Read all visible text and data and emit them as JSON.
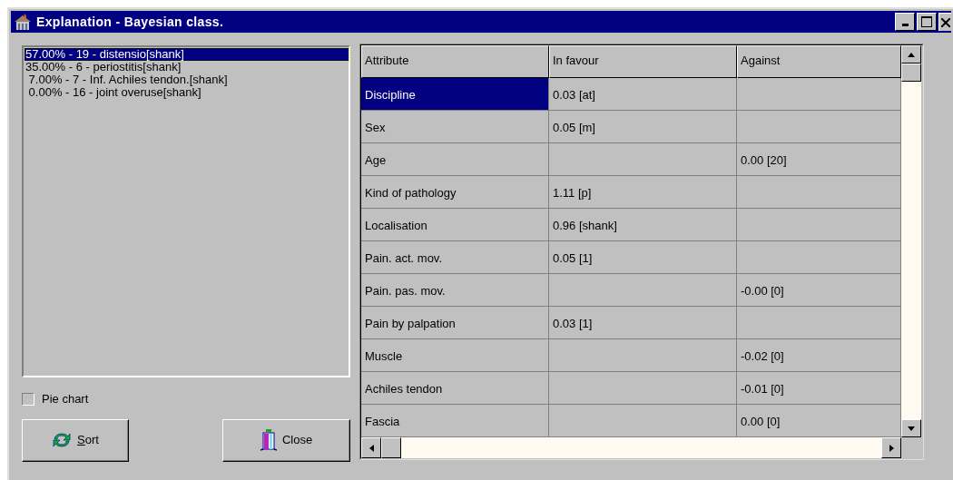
{
  "window": {
    "title": "Explanation - Bayesian class."
  },
  "classes": [
    {
      "label": "57.00% - 19 - distensio[shank]",
      "selected": true
    },
    {
      "label": "35.00% - 6 - periostitis[shank]",
      "selected": false
    },
    {
      "label": " 7.00% - 7 - Inf. Achiles tendon.[shank]",
      "selected": false
    },
    {
      "label": " 0.00% - 16 - joint overuse[shank]",
      "selected": false
    }
  ],
  "pie_chart": {
    "label": "Pie chart",
    "checked": false
  },
  "buttons": [
    {
      "label": "Sort",
      "kind": "sort"
    },
    {
      "label": "Close",
      "kind": "close"
    }
  ],
  "table": {
    "columns": [
      "Attribute",
      "In favour",
      "Against"
    ],
    "rows": [
      {
        "attribute": "Discipline",
        "in_favour": "0.03 [at]",
        "selected": true
      },
      {
        "attribute": "Sex",
        "in_favour": "0.05 [m]",
        "selected": false
      },
      {
        "attribute": "Age",
        "against": "0.00 [20]",
        "selected": false
      },
      {
        "attribute": "Kind of pathology",
        "in_favour": "1.11 [p]",
        "selected": false
      },
      {
        "attribute": "Localisation",
        "in_favour": "0.96 [shank]",
        "selected": false
      },
      {
        "attribute": "Pain. act. mov.",
        "in_favour": "0.05 [1]",
        "selected": false
      },
      {
        "attribute": "Pain. pas. mov.",
        "against": "-0.00 [0]",
        "selected": false
      },
      {
        "attribute": "Pain by palpation",
        "in_favour": "0.03 [1]",
        "selected": false
      },
      {
        "attribute": "Muscle",
        "against": "-0.02 [0]",
        "selected": false
      },
      {
        "attribute": "Achiles tendon",
        "against": "-0.01 [0]",
        "selected": false
      },
      {
        "attribute": "Fascia",
        "against": "0.00 [0]",
        "selected": false
      }
    ]
  }
}
